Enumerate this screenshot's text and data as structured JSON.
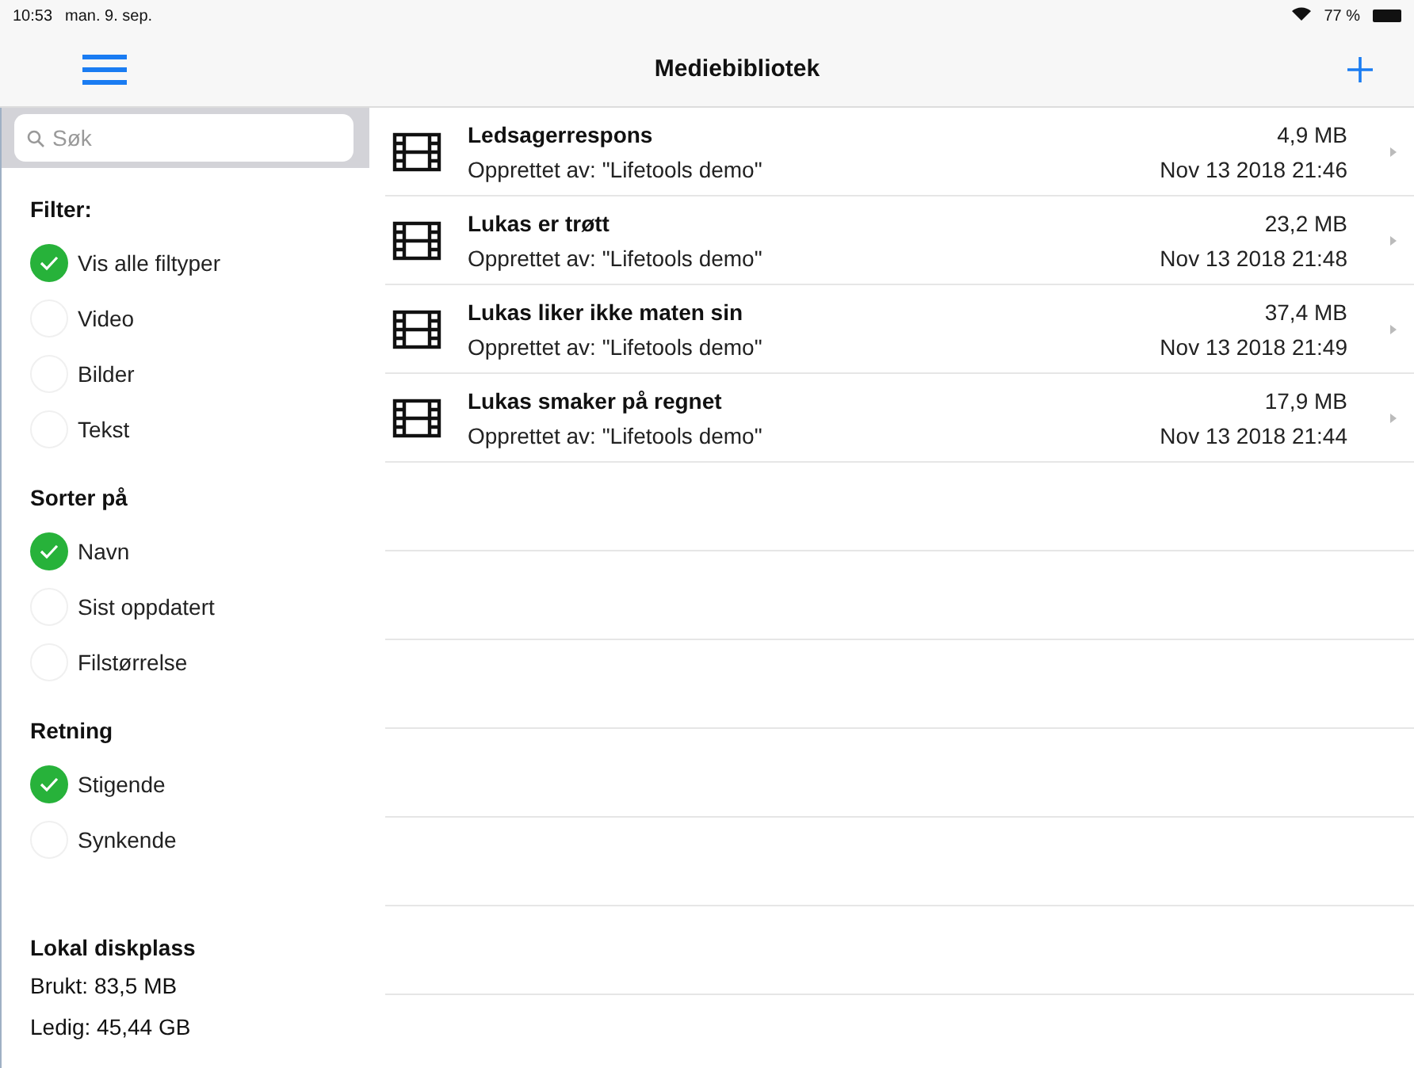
{
  "status_bar": {
    "time": "10:53",
    "date": "man. 9. sep.",
    "battery": "77 %"
  },
  "nav_bar": {
    "title": "Mediebibliotek"
  },
  "sidebar": {
    "search": {
      "placeholder": "Søk"
    },
    "groups": [
      {
        "title": "Filter:",
        "options": [
          {
            "label": "Vis alle filtyper",
            "selected": true
          },
          {
            "label": "Video",
            "selected": false
          },
          {
            "label": "Bilder",
            "selected": false
          },
          {
            "label": "Tekst",
            "selected": false
          }
        ]
      },
      {
        "title": "Sorter på",
        "options": [
          {
            "label": "Navn",
            "selected": true
          },
          {
            "label": "Sist oppdatert",
            "selected": false
          },
          {
            "label": "Filstørrelse",
            "selected": false
          }
        ]
      },
      {
        "title": "Retning",
        "options": [
          {
            "label": "Stigende",
            "selected": true
          },
          {
            "label": "Synkende",
            "selected": false
          }
        ]
      }
    ],
    "disk": {
      "title": "Lokal diskplass",
      "used": "Brukt: 83,5 MB",
      "free": "Ledig: 45,44 GB"
    }
  },
  "media": [
    {
      "title": "Ledsagerrespons",
      "creator": "Opprettet av: \"Lifetools demo\"",
      "size": "4,9 MB",
      "date": "Nov 13 2018 21:46"
    },
    {
      "title": "Lukas er trøtt",
      "creator": "Opprettet av: \"Lifetools demo\"",
      "size": "23,2 MB",
      "date": "Nov 13 2018 21:48"
    },
    {
      "title": "Lukas liker ikke maten sin",
      "creator": "Opprettet av: \"Lifetools demo\"",
      "size": "37,4 MB",
      "date": "Nov 13 2018 21:49"
    },
    {
      "title": "Lukas smaker på regnet",
      "creator": "Opprettet av: \"Lifetools demo\"",
      "size": "17,9 MB",
      "date": "Nov 13 2018 21:44"
    }
  ]
}
